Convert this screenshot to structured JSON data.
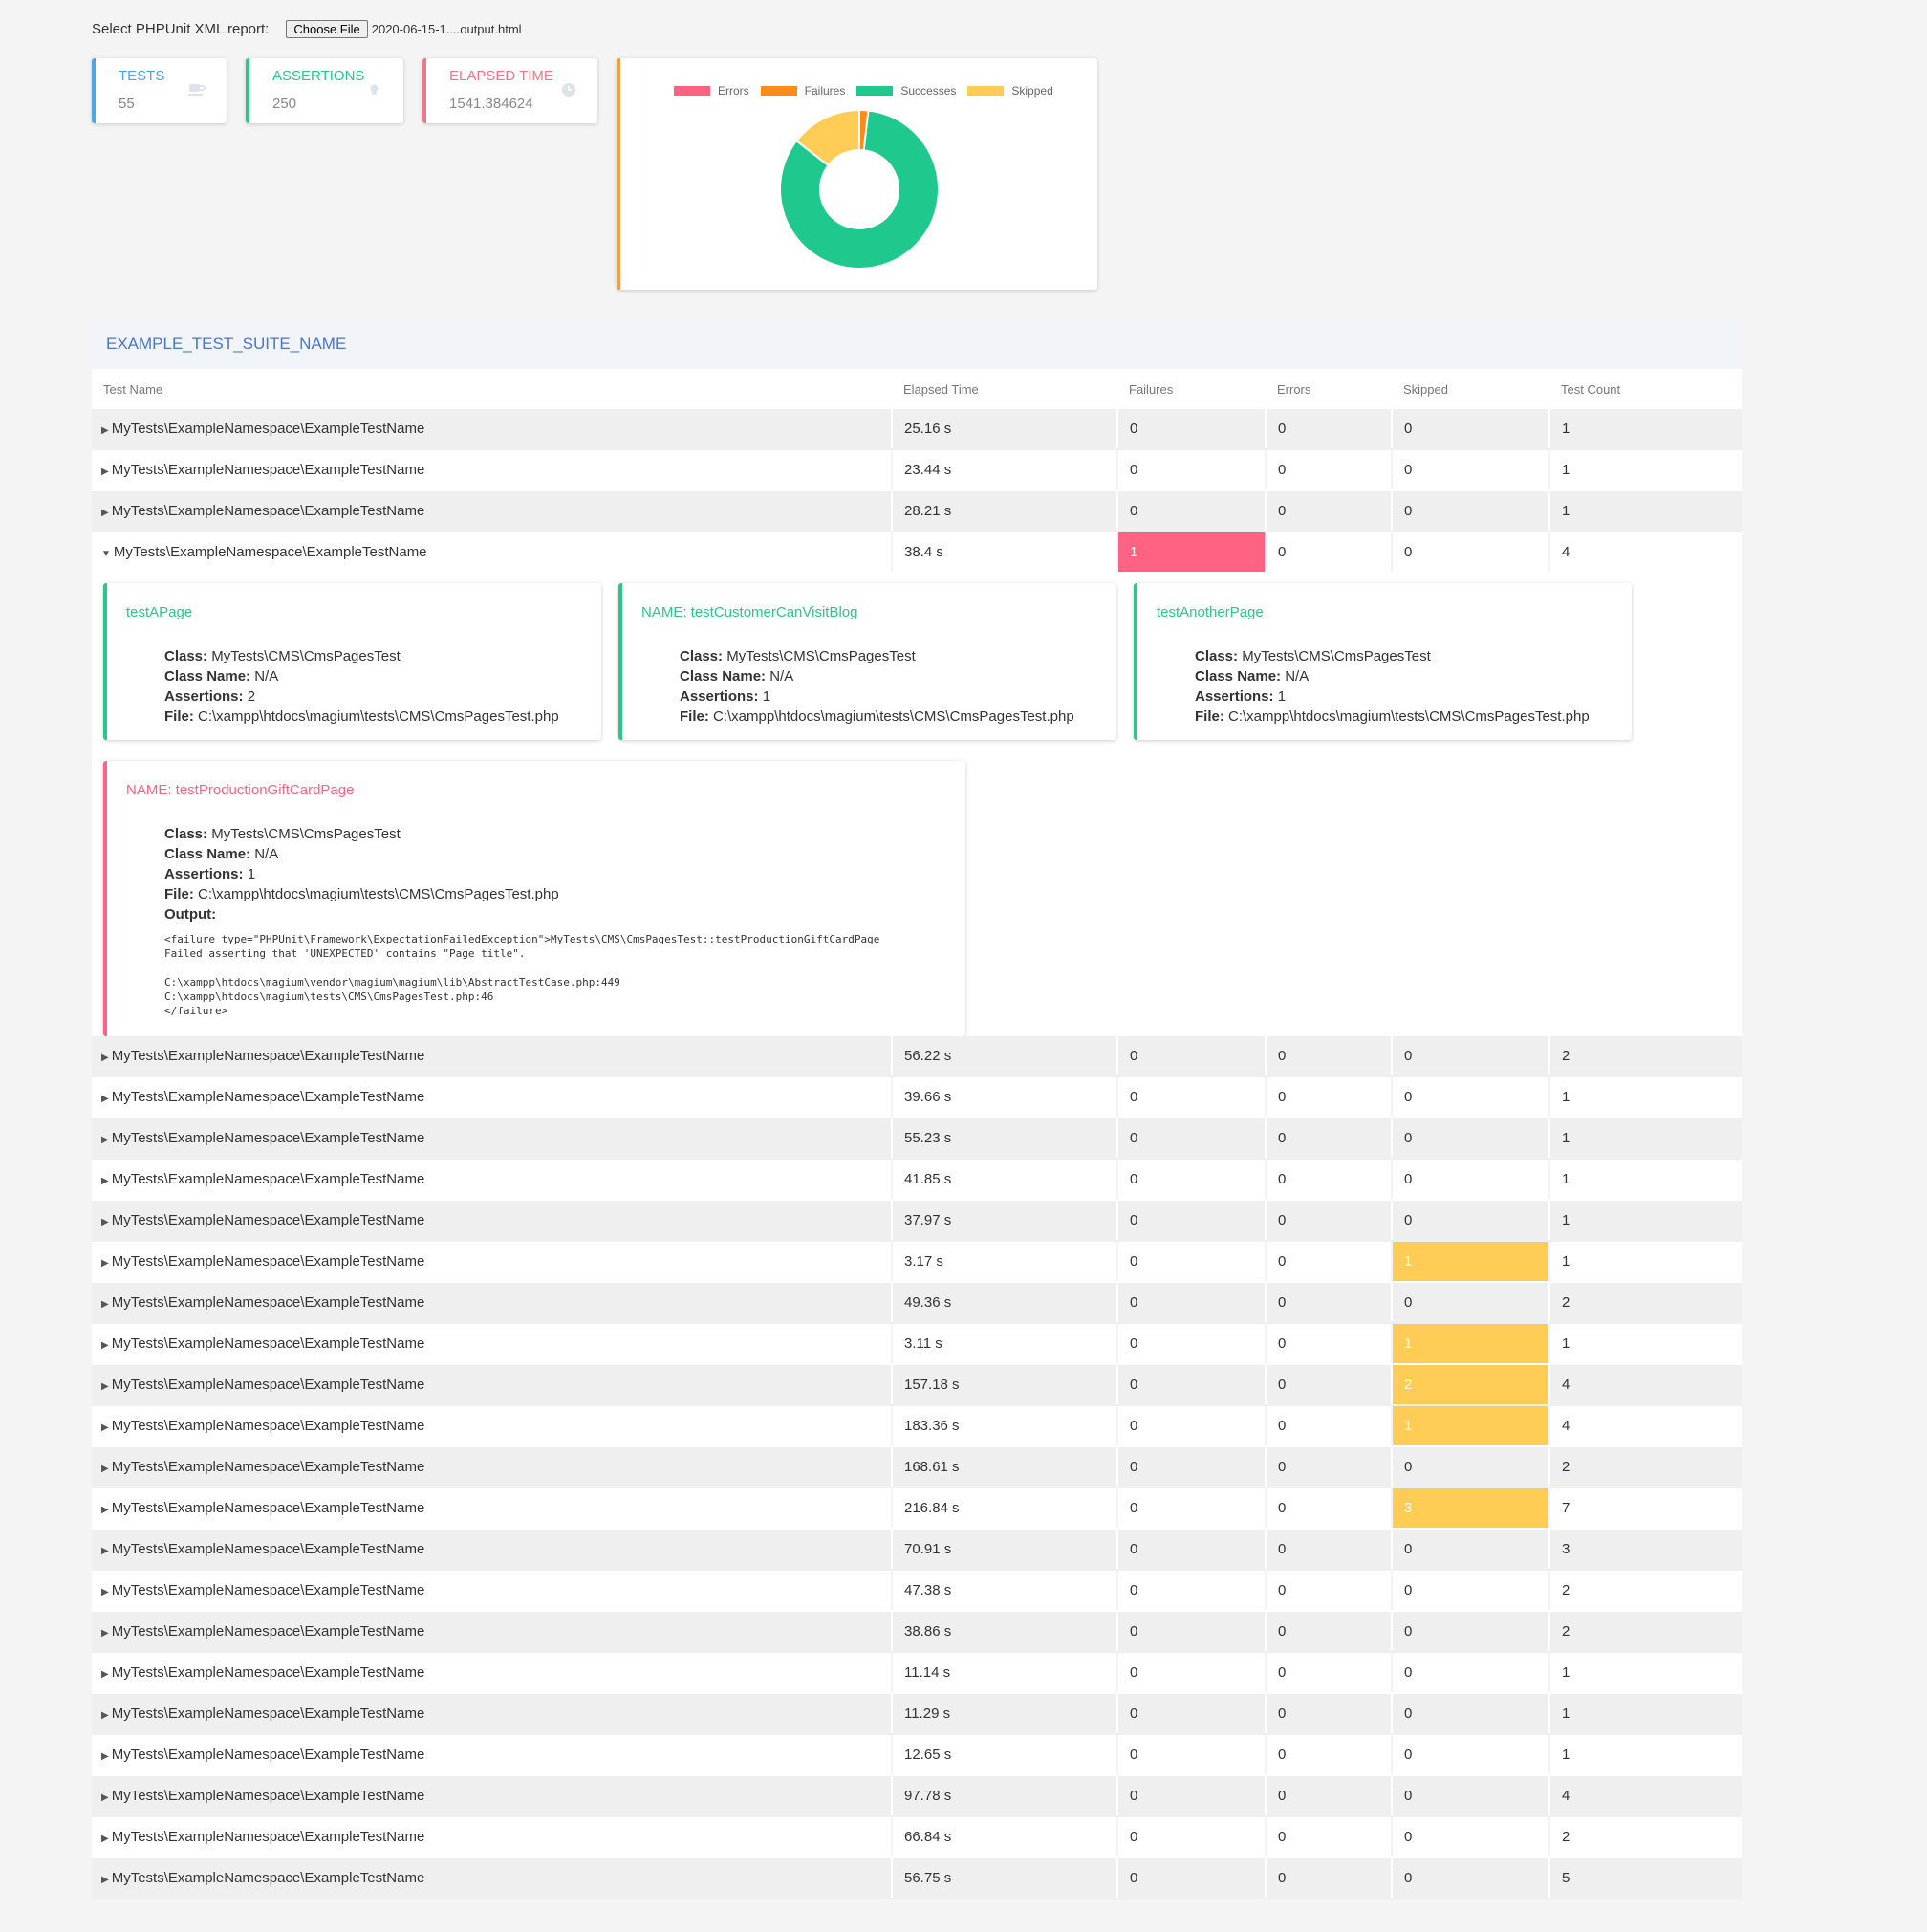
{
  "file": {
    "label": "Select PHPUnit XML report:",
    "button": "Choose File",
    "filename": "2020-06-15-1....output.html"
  },
  "stats": {
    "tests": {
      "title": "TESTS",
      "value": "55",
      "color": "#4ea6e3"
    },
    "assertions": {
      "title": "ASSERTIONS",
      "value": "250",
      "color": "#2dc58d"
    },
    "elapsed": {
      "title": "ELAPSED TIME",
      "value": "1541.384624",
      "color": "#ea7a87"
    }
  },
  "chart_data": {
    "type": "pie",
    "donut": true,
    "legend_position": "top",
    "categories": [
      "Errors",
      "Failures",
      "Successes",
      "Skipped"
    ],
    "values": [
      0,
      1,
      46,
      8
    ],
    "colors": [
      "#ff6384",
      "#ff8c1a",
      "#1fc98e",
      "#ffcd56"
    ]
  },
  "suite": {
    "name": "EXAMPLE_TEST_SUITE_NAME"
  },
  "columns": {
    "name": "Test Name",
    "time": "Elapsed Time",
    "failures": "Failures",
    "errors": "Errors",
    "skipped": "Skipped",
    "count": "Test Count"
  },
  "rows_top": [
    {
      "name": "MyTests\\ExampleNamespace\\ExampleTestName",
      "time": "25.16 s",
      "failures": "0",
      "errors": "0",
      "skipped": "0",
      "count": "1"
    },
    {
      "name": "MyTests\\ExampleNamespace\\ExampleTestName",
      "time": "23.44 s",
      "failures": "0",
      "errors": "0",
      "skipped": "0",
      "count": "1"
    },
    {
      "name": "MyTests\\ExampleNamespace\\ExampleTestName",
      "time": "28.21 s",
      "failures": "0",
      "errors": "0",
      "skipped": "0",
      "count": "1"
    },
    {
      "name": "MyTests\\ExampleNamespace\\ExampleTestName",
      "time": "38.4 s",
      "failures": "1",
      "errors": "0",
      "skipped": "0",
      "count": "4",
      "expanded": true
    }
  ],
  "cases": [
    {
      "name": "testAPage",
      "class": "MyTests\\CMS\\CmsPagesTest",
      "class_name": "N/A",
      "assertions": "2",
      "file": "C:\\xampp\\htdocs\\magium\\tests\\CMS\\CmsPagesTest.php",
      "status": "success"
    },
    {
      "name": "NAME: testCustomerCanVisitBlog",
      "class": "MyTests\\CMS\\CmsPagesTest",
      "class_name": "N/A",
      "assertions": "1",
      "file": "C:\\xampp\\htdocs\\magium\\tests\\CMS\\CmsPagesTest.php",
      "status": "success"
    },
    {
      "name": "testAnotherPage",
      "class": "MyTests\\CMS\\CmsPagesTest",
      "class_name": "N/A",
      "assertions": "1",
      "file": "C:\\xampp\\htdocs\\magium\\tests\\CMS\\CmsPagesTest.php",
      "status": "success"
    },
    {
      "name": "NAME: testProductionGiftCardPage",
      "class": "MyTests\\CMS\\CmsPagesTest",
      "class_name": "N/A",
      "assertions": "1",
      "file": "C:\\xampp\\htdocs\\magium\\tests\\CMS\\CmsPagesTest.php",
      "status": "failure",
      "output_label": "Output:",
      "output": "<failure type=\"PHPUnit\\Framework\\ExpectationFailedException\">MyTests\\CMS\\CmsPagesTest::testProductionGiftCardPage\nFailed asserting that 'UNEXPECTED' contains \"Page title\".\n\nC:\\xampp\\htdocs\\magium\\vendor\\magium\\magium\\lib\\AbstractTestCase.php:449\nC:\\xampp\\htdocs\\magium\\tests\\CMS\\CmsPagesTest.php:46\n</failure>"
    }
  ],
  "labels": {
    "class": "Class:",
    "class_name": "Class Name:",
    "assertions": "Assertions:",
    "file": "File:"
  },
  "status_colors": {
    "success": "#2dc58d",
    "failure": "#ff6384",
    "skip": "#ffcd56"
  },
  "rows_bottom": [
    {
      "name": "MyTests\\ExampleNamespace\\ExampleTestName",
      "time": "56.22 s",
      "failures": "0",
      "errors": "0",
      "skipped": "0",
      "count": "2"
    },
    {
      "name": "MyTests\\ExampleNamespace\\ExampleTestName",
      "time": "39.66 s",
      "failures": "0",
      "errors": "0",
      "skipped": "0",
      "count": "1"
    },
    {
      "name": "MyTests\\ExampleNamespace\\ExampleTestName",
      "time": "55.23 s",
      "failures": "0",
      "errors": "0",
      "skipped": "0",
      "count": "1"
    },
    {
      "name": "MyTests\\ExampleNamespace\\ExampleTestName",
      "time": "41.85 s",
      "failures": "0",
      "errors": "0",
      "skipped": "0",
      "count": "1"
    },
    {
      "name": "MyTests\\ExampleNamespace\\ExampleTestName",
      "time": "37.97 s",
      "failures": "0",
      "errors": "0",
      "skipped": "0",
      "count": "1"
    },
    {
      "name": "MyTests\\ExampleNamespace\\ExampleTestName",
      "time": "3.17 s",
      "failures": "0",
      "errors": "0",
      "skipped": "1",
      "count": "1"
    },
    {
      "name": "MyTests\\ExampleNamespace\\ExampleTestName",
      "time": "49.36 s",
      "failures": "0",
      "errors": "0",
      "skipped": "0",
      "count": "2"
    },
    {
      "name": "MyTests\\ExampleNamespace\\ExampleTestName",
      "time": "3.11 s",
      "failures": "0",
      "errors": "0",
      "skipped": "1",
      "count": "1"
    },
    {
      "name": "MyTests\\ExampleNamespace\\ExampleTestName",
      "time": "157.18 s",
      "failures": "0",
      "errors": "0",
      "skipped": "2",
      "count": "4"
    },
    {
      "name": "MyTests\\ExampleNamespace\\ExampleTestName",
      "time": "183.36 s",
      "failures": "0",
      "errors": "0",
      "skipped": "1",
      "count": "4"
    },
    {
      "name": "MyTests\\ExampleNamespace\\ExampleTestName",
      "time": "168.61 s",
      "failures": "0",
      "errors": "0",
      "skipped": "0",
      "count": "2"
    },
    {
      "name": "MyTests\\ExampleNamespace\\ExampleTestName",
      "time": "216.84 s",
      "failures": "0",
      "errors": "0",
      "skipped": "3",
      "count": "7"
    },
    {
      "name": "MyTests\\ExampleNamespace\\ExampleTestName",
      "time": "70.91 s",
      "failures": "0",
      "errors": "0",
      "skipped": "0",
      "count": "3"
    },
    {
      "name": "MyTests\\ExampleNamespace\\ExampleTestName",
      "time": "47.38 s",
      "failures": "0",
      "errors": "0",
      "skipped": "0",
      "count": "2"
    },
    {
      "name": "MyTests\\ExampleNamespace\\ExampleTestName",
      "time": "38.86 s",
      "failures": "0",
      "errors": "0",
      "skipped": "0",
      "count": "2"
    },
    {
      "name": "MyTests\\ExampleNamespace\\ExampleTestName",
      "time": "11.14 s",
      "failures": "0",
      "errors": "0",
      "skipped": "0",
      "count": "1"
    },
    {
      "name": "MyTests\\ExampleNamespace\\ExampleTestName",
      "time": "11.29 s",
      "failures": "0",
      "errors": "0",
      "skipped": "0",
      "count": "1"
    },
    {
      "name": "MyTests\\ExampleNamespace\\ExampleTestName",
      "time": "12.65 s",
      "failures": "0",
      "errors": "0",
      "skipped": "0",
      "count": "1"
    },
    {
      "name": "MyTests\\ExampleNamespace\\ExampleTestName",
      "time": "97.78 s",
      "failures": "0",
      "errors": "0",
      "skipped": "0",
      "count": "4"
    },
    {
      "name": "MyTests\\ExampleNamespace\\ExampleTestName",
      "time": "66.84 s",
      "failures": "0",
      "errors": "0",
      "skipped": "0",
      "count": "2"
    },
    {
      "name": "MyTests\\ExampleNamespace\\ExampleTestName",
      "time": "56.75 s",
      "failures": "0",
      "errors": "0",
      "skipped": "0",
      "count": "5"
    }
  ]
}
